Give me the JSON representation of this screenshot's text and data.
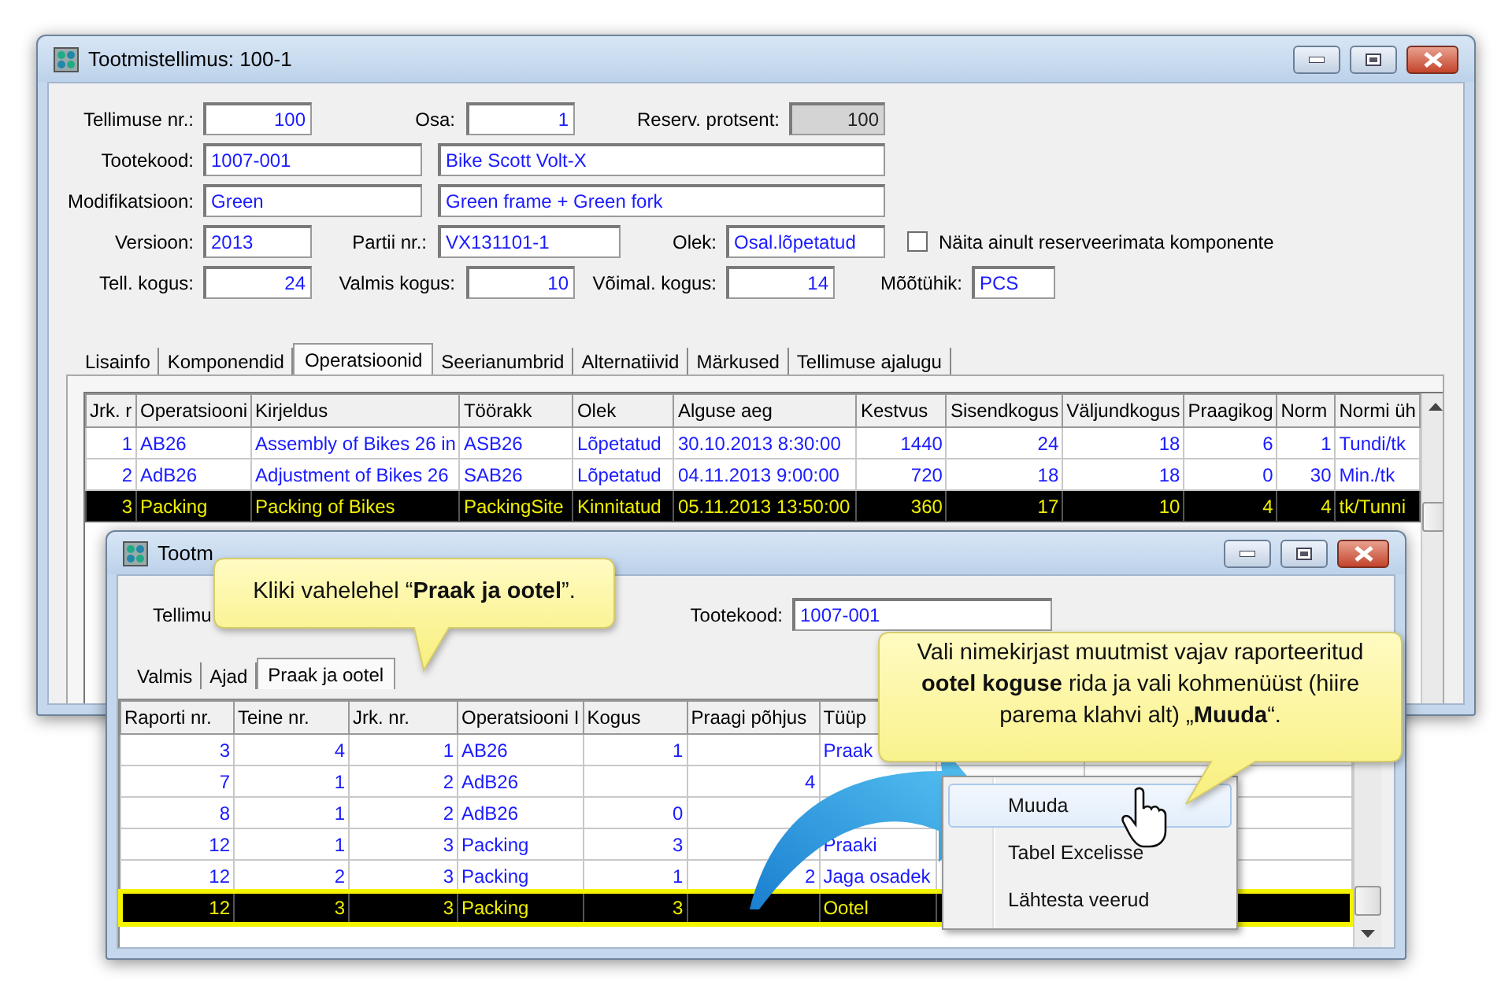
{
  "main_window": {
    "title": "Tootmistellimus: 100-1",
    "form_rows": [
      [
        {
          "kind": "label",
          "text": "Tellimuse nr.:"
        },
        {
          "kind": "field",
          "value": "100",
          "disabled": false
        },
        {
          "kind": "label",
          "text": "Osa:"
        },
        {
          "kind": "field",
          "value": "1",
          "disabled": false
        },
        {
          "kind": "label",
          "text": "Reserv. protsent:"
        },
        {
          "kind": "field",
          "value": "100",
          "disabled": true
        }
      ],
      [
        {
          "kind": "label",
          "text": "Tootekood:"
        },
        {
          "kind": "field",
          "value": "1007-001",
          "disabled": false
        },
        {
          "kind": "field",
          "value": "Bike Scott Volt-X",
          "disabled": false
        }
      ],
      [
        {
          "kind": "label",
          "text": "Modifikatsioon:"
        },
        {
          "kind": "field",
          "value": "Green",
          "disabled": false
        },
        {
          "kind": "field",
          "value": "Green frame + Green fork",
          "disabled": false
        }
      ],
      [
        {
          "kind": "label",
          "text": "Versioon:"
        },
        {
          "kind": "field",
          "value": "2013",
          "disabled": false
        },
        {
          "kind": "label",
          "text": "Partii nr.:"
        },
        {
          "kind": "field",
          "value": "VX131101-1",
          "disabled": false
        },
        {
          "kind": "label",
          "text": "Olek:"
        },
        {
          "kind": "field",
          "value": "Osal.lõpetatud",
          "disabled": false
        },
        {
          "kind": "checkbox",
          "label": "Näita ainult reserveerimata komponente",
          "checked": false
        }
      ],
      [
        {
          "kind": "label",
          "text": "Tell. kogus:"
        },
        {
          "kind": "field",
          "value": "24",
          "disabled": false
        },
        {
          "kind": "label",
          "text": "Valmis kogus:"
        },
        {
          "kind": "field",
          "value": "10",
          "disabled": false
        },
        {
          "kind": "label",
          "text": "Võimal. kogus:"
        },
        {
          "kind": "field",
          "value": "14",
          "disabled": false
        },
        {
          "kind": "label",
          "text": "Mõõtühik:"
        },
        {
          "kind": "field",
          "value": "PCS",
          "disabled": false
        }
      ]
    ],
    "tabs": [
      {
        "label": "Lisainfo",
        "selected": false
      },
      {
        "label": "Komponendid",
        "selected": false
      },
      {
        "label": "Operatsioonid",
        "selected": true
      },
      {
        "label": "Seerianumbrid",
        "selected": false
      },
      {
        "label": "Alternatiivid",
        "selected": false
      },
      {
        "label": "Märkused",
        "selected": false
      },
      {
        "label": "Tellimuse ajalugu",
        "selected": false
      }
    ],
    "table": {
      "columns": [
        "Jrk. r",
        "Operatsiooni",
        "Kirjeldus",
        "Töörakk",
        "Olek",
        "Alguse aeg",
        "Kestvus",
        "Sisendkogus",
        "Väljundkogus",
        "Praagikog",
        "Norm",
        "Normi üh"
      ],
      "rows": [
        {
          "selected": false,
          "cells": [
            "1",
            "AB26",
            "Assembly of Bikes 26 in",
            "ASB26",
            "Lõpetatud",
            "30.10.2013 8:30:00",
            "1440",
            "24",
            "18",
            "6",
            "1",
            "Tundi/tk"
          ]
        },
        {
          "selected": false,
          "cells": [
            "2",
            "AdB26",
            "Adjustment of Bikes 26",
            "SAB26",
            "Lõpetatud",
            "04.11.2013 9:00:00",
            "720",
            "18",
            "18",
            "0",
            "30",
            "Min./tk"
          ]
        },
        {
          "selected": true,
          "cells": [
            "3",
            "Packing",
            "Packing of Bikes",
            "PackingSite",
            "Kinnitatud",
            "05.11.2013 13:50:00",
            "360",
            "17",
            "10",
            "4",
            "4",
            "tk/Tunni"
          ]
        }
      ]
    }
  },
  "report_window": {
    "title": "Tootm",
    "form": [
      {
        "kind": "label",
        "text": "Tellimu"
      },
      {
        "kind": "label",
        "text": "Tootekood:"
      },
      {
        "kind": "field",
        "value": "1007-001",
        "disabled": false
      }
    ],
    "tabs": [
      {
        "label": "Valmis",
        "selected": false
      },
      {
        "label": "Ajad",
        "selected": false
      },
      {
        "label": "Praak ja ootel",
        "selected": true
      }
    ],
    "table": {
      "columns": [
        "Raporti nr.",
        "Teine nr.",
        "Jrk. nr.",
        "Operatsiooni I",
        "Kogus",
        "Praagi põhjus",
        "Tüüp"
      ],
      "rows": [
        {
          "selected": false,
          "cells": [
            "3",
            "4",
            "1",
            "AB26",
            "1",
            null,
            "Praak"
          ]
        },
        {
          "selected": false,
          "cells": [
            "7",
            "1",
            "2",
            "AdB26",
            null,
            "4",
            null
          ]
        },
        {
          "selected": false,
          "cells": [
            "8",
            "1",
            "2",
            "AdB26",
            "0",
            null,
            null
          ]
        },
        {
          "selected": false,
          "cells": [
            "12",
            "1",
            "3",
            "Packing",
            "3",
            null,
            "Praaki"
          ]
        },
        {
          "selected": false,
          "cells": [
            "12",
            "2",
            "3",
            "Packing",
            "1",
            "2",
            "Jaga osadek"
          ]
        },
        {
          "selected": true,
          "cells": [
            "12",
            "3",
            "3",
            "Packing",
            "3",
            null,
            "Ootel"
          ]
        }
      ]
    }
  },
  "context_menu": {
    "items": [
      {
        "label": "Muuda",
        "selected": true
      },
      {
        "label": "Tabel Excelisse",
        "selected": false
      },
      {
        "label": "Lähtesta veerud",
        "selected": false
      }
    ]
  },
  "callouts": [
    {
      "text": "Kliki vahelehel “**Praak ja ootel**”."
    },
    {
      "text": "Vali nimekirjast muutmist vajav raporteeritud **ootel koguse** rida ja vali kohmenüüst (hiire parema klahvi alt) „**Muuda**“."
    }
  ]
}
